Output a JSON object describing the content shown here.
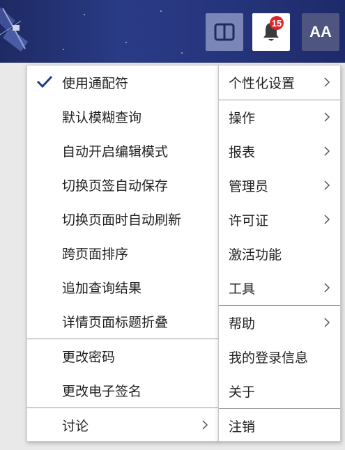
{
  "topbar": {
    "layout_icon": "split-layout-icon",
    "bell_icon": "bell-icon",
    "notification_count": "15",
    "font_button_label": "AA",
    "colors": {
      "header_bg": "#25337a",
      "badge": "#d9272b",
      "check": "#1a3a8f"
    }
  },
  "submenu": {
    "items": [
      {
        "label": "使用通配符",
        "checked": true
      },
      {
        "label": "默认模糊查询"
      },
      {
        "label": "自动开启编辑模式"
      },
      {
        "label": "切换页签自动保存"
      },
      {
        "label": "切换页面时自动刷新"
      },
      {
        "label": "跨页面排序"
      },
      {
        "label": "追加查询结果"
      },
      {
        "label": "详情页面标题折叠"
      },
      {
        "label": "更改密码"
      },
      {
        "label": "更改电子签名"
      },
      {
        "label": "讨论",
        "has_submenu": true
      }
    ]
  },
  "mainmenu": {
    "items": [
      {
        "label": "个性化设置",
        "has_submenu": true
      },
      {
        "label": "操作",
        "has_submenu": true
      },
      {
        "label": "报表",
        "has_submenu": true
      },
      {
        "label": "管理员",
        "has_submenu": true
      },
      {
        "label": "许可证",
        "has_submenu": true
      },
      {
        "label": "激活功能"
      },
      {
        "label": "工具",
        "has_submenu": true
      },
      {
        "label": "帮助",
        "has_submenu": true
      },
      {
        "label": "我的登录信息"
      },
      {
        "label": "关于"
      },
      {
        "label": "注销"
      }
    ]
  }
}
